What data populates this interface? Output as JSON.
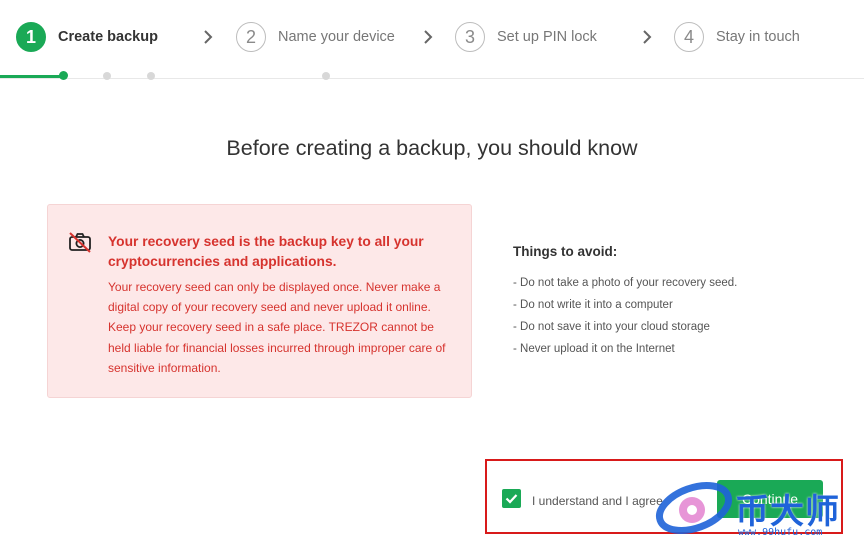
{
  "stepper": {
    "steps": [
      {
        "number": "1",
        "label": "Create backup"
      },
      {
        "number": "2",
        "label": "Name your device"
      },
      {
        "number": "3",
        "label": "Set up PIN lock"
      },
      {
        "number": "4",
        "label": "Stay in touch"
      }
    ],
    "active_step": 1,
    "icons": {
      "separator": "chevron-right-icon"
    }
  },
  "main": {
    "heading": "Before creating a backup, you should know",
    "warning": {
      "icon": "no-camera-icon",
      "title": "Your recovery seed is the backup key to all your cryptocurrencies and applications.",
      "body": "Your recovery seed can only be displayed once. Never make a digital copy of your recovery seed and never upload it online. Keep your recovery seed in a safe place. TREZOR cannot be held liable for financial losses incurred through improper care of sensitive information."
    },
    "avoid": {
      "title": "Things to avoid:",
      "items": [
        "- Do not take a photo of your recovery seed.",
        "- Do not write it into a computer",
        "- Do not save it into your cloud storage",
        "- Never upload it on the Internet"
      ]
    }
  },
  "footer": {
    "agree_label": "I understand and I agree",
    "agree_checked": true,
    "continue_label": "Continue"
  },
  "watermark": {
    "text": "币大师",
    "url": "www.99hufu.com"
  },
  "colors": {
    "accent": "#1aa956",
    "warning_bg": "#fde8e8",
    "warning_text": "#d6332e",
    "highlight_border": "#d81a1a"
  }
}
